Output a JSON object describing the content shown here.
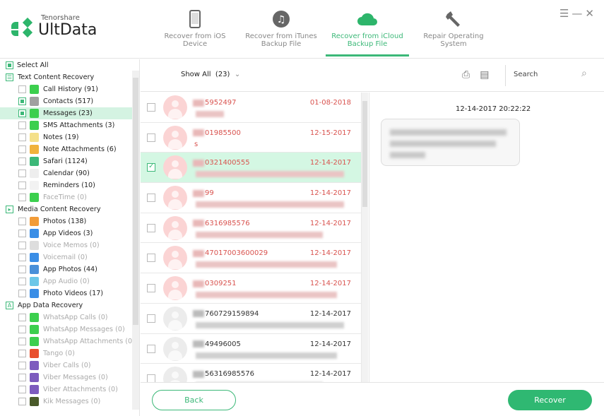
{
  "app": {
    "brand_small": "Tenorshare",
    "brand_big": "UltData",
    "accent": "#3cb878"
  },
  "tabs": [
    {
      "label": "Recover from iOS Device",
      "icon": "phone-icon"
    },
    {
      "label": "Recover from iTunes Backup File",
      "icon": "music-icon"
    },
    {
      "label": "Recover from iCloud Backup File",
      "icon": "cloud-icon",
      "active": true
    },
    {
      "label": "Repair Operating System",
      "icon": "wrench-icon"
    }
  ],
  "window": {
    "menu": "☰",
    "minimize": "—",
    "close": "✕"
  },
  "sidebar": {
    "select_all": "Select All",
    "sections": [
      {
        "label": "Text Content Recovery",
        "items": [
          {
            "label": "Call History (91)",
            "color": "#3ccf4e"
          },
          {
            "label": "Contacts (517)",
            "color": "#a0a0a0",
            "checked": true
          },
          {
            "label": "Messages (23)",
            "color": "#3ccf4e",
            "checked": true,
            "selected": true
          },
          {
            "label": "SMS Attachments (3)",
            "color": "#3ccf4e"
          },
          {
            "label": "Notes (19)",
            "color": "#f4e08a"
          },
          {
            "label": "Note Attachments (6)",
            "color": "#f0b23c"
          },
          {
            "label": "Safari (1124)",
            "color": "#3cb878"
          },
          {
            "label": "Calendar (90)",
            "color": "#eeeeee"
          },
          {
            "label": "Reminders (10)",
            "color": "#f2f2f2"
          },
          {
            "label": "FaceTime (0)",
            "color": "#3ccf4e",
            "disabled": true
          }
        ]
      },
      {
        "label": "Media Content Recovery",
        "items": [
          {
            "label": "Photos (138)",
            "color": "#f29c38"
          },
          {
            "label": "App Videos (3)",
            "color": "#3a8ee6"
          },
          {
            "label": "Voice Memos (0)",
            "color": "#dddddd",
            "disabled": true
          },
          {
            "label": "Voicemail (0)",
            "color": "#3a8ee6",
            "disabled": true
          },
          {
            "label": "App Photos (44)",
            "color": "#4a90d9"
          },
          {
            "label": "App Audio (0)",
            "color": "#6cc7e8",
            "disabled": true
          },
          {
            "label": "Photo Videos (17)",
            "color": "#3a8ee6"
          }
        ]
      },
      {
        "label": "App Data Recovery",
        "items": [
          {
            "label": "WhatsApp Calls (0)",
            "color": "#3ccf4e",
            "disabled": true
          },
          {
            "label": "WhatsApp Messages (0)",
            "color": "#3ccf4e",
            "disabled": true
          },
          {
            "label": "WhatsApp Attachments (0)",
            "color": "#3ccf4e",
            "disabled": true
          },
          {
            "label": "Tango (0)",
            "color": "#e8502e",
            "disabled": true
          },
          {
            "label": "Viber Calls (0)",
            "color": "#7d5bbe",
            "disabled": true
          },
          {
            "label": "Viber Messages (0)",
            "color": "#7d5bbe",
            "disabled": true
          },
          {
            "label": "Viber Attachments (0)",
            "color": "#7d5bbe",
            "disabled": true
          },
          {
            "label": "Kik Messages (0)",
            "color": "#4a5a2a",
            "disabled": true
          }
        ]
      }
    ]
  },
  "toolbar": {
    "show_all": "Show All",
    "count": "(23)",
    "search_placeholder": "Search"
  },
  "messages": [
    {
      "number": "5952497",
      "date": "01-08-2018",
      "deleted": true,
      "preview": 40
    },
    {
      "number": "01985500",
      "date": "12-15-2017",
      "deleted": true,
      "preview": 6,
      "preview_text": "s"
    },
    {
      "number": "0321400555",
      "date": "12-14-2017",
      "deleted": true,
      "preview": 210,
      "selected": true,
      "checked": true
    },
    {
      "number": "99",
      "date": "12-14-2017",
      "deleted": true,
      "preview": 210
    },
    {
      "number": "6316985576",
      "date": "12-14-2017",
      "deleted": true,
      "preview": 180
    },
    {
      "number": "47017003600029",
      "date": "12-14-2017",
      "deleted": true,
      "preview": 200
    },
    {
      "number": "0309251",
      "date": "12-14-2017",
      "deleted": true,
      "preview": 200
    },
    {
      "number": "760729159894",
      "date": "12-14-2017",
      "deleted": false,
      "preview": 210
    },
    {
      "number": "49496005",
      "date": "12-14-2017",
      "deleted": false,
      "preview": 200
    },
    {
      "number": "56316985576",
      "date": "12-14-2017",
      "deleted": false,
      "preview": 180
    }
  ],
  "detail": {
    "timestamp": "12-14-2017 20:22:22"
  },
  "footer": {
    "back": "Back",
    "recover": "Recover"
  }
}
